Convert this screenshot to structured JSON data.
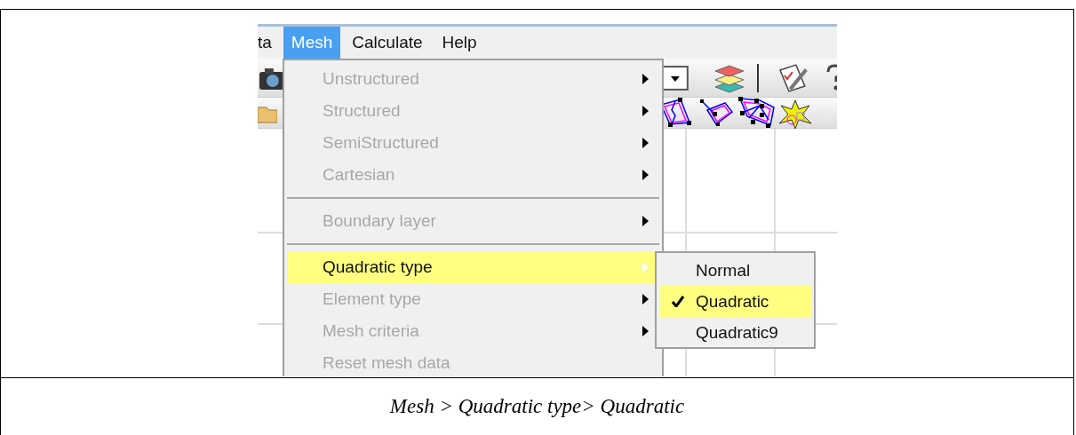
{
  "menubar": [
    {
      "label": "ta",
      "selected": false
    },
    {
      "label": "Mesh",
      "selected": true
    },
    {
      "label": "Calculate",
      "selected": false
    },
    {
      "label": "Help",
      "selected": false
    }
  ],
  "menu": {
    "items": [
      {
        "kind": "item",
        "label": "Unstructured",
        "disabled": true,
        "selected": false
      },
      {
        "kind": "item",
        "label": "Structured",
        "disabled": true,
        "selected": false
      },
      {
        "kind": "item",
        "label": "SemiStructured",
        "disabled": true,
        "selected": false
      },
      {
        "kind": "item",
        "label": "Cartesian",
        "disabled": true,
        "selected": false
      },
      {
        "kind": "separator"
      },
      {
        "kind": "item",
        "label": "Boundary layer",
        "disabled": true,
        "selected": false
      },
      {
        "kind": "separator"
      },
      {
        "kind": "item",
        "label": "Quadratic type",
        "disabled": false,
        "selected": true
      },
      {
        "kind": "item",
        "label": "Element type",
        "disabled": true,
        "selected": false
      },
      {
        "kind": "item",
        "label": "Mesh criteria",
        "disabled": true,
        "selected": false
      },
      {
        "kind": "plain",
        "label": "Reset mesh data",
        "disabled": true,
        "selected": false
      }
    ]
  },
  "submenu": {
    "items": [
      {
        "label": "Normal",
        "checked": false,
        "selected": false
      },
      {
        "label": "Quadratic",
        "checked": true,
        "selected": true
      },
      {
        "label": "Quadratic9",
        "checked": false,
        "selected": false
      }
    ]
  },
  "caption": "Mesh > Quadratic type> Quadratic"
}
